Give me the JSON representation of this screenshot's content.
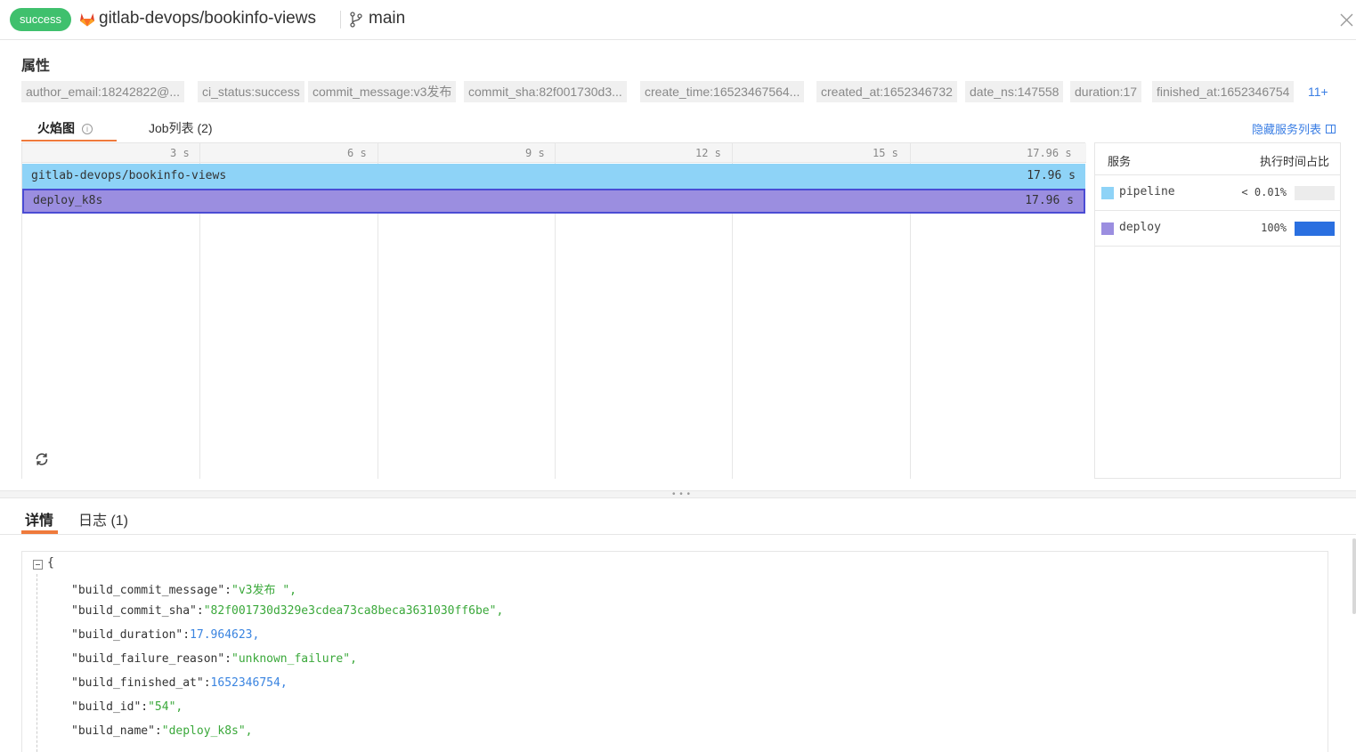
{
  "header": {
    "status": "success",
    "repo": "gitlab-devops/bookinfo-views",
    "branch": "main"
  },
  "attributes": {
    "title": "属性",
    "tags": [
      "author_email:18242822@...",
      "ci_status:success",
      "commit_message:v3发布",
      "commit_sha:82f001730d3...",
      "create_time:16523467564...",
      "created_at:1652346732",
      "date_ns:147558",
      "duration:17",
      "finished_at:1652346754"
    ],
    "more": "11+"
  },
  "tabs": {
    "flame": "火焰图",
    "jobs": "Job列表 (2)",
    "hide_services": "隐藏服务列表"
  },
  "flame": {
    "ticks": [
      "3 s",
      "6 s",
      "9 s",
      "12 s",
      "15 s",
      "17.96 s"
    ],
    "bars": [
      {
        "name": "gitlab-devops/bookinfo-views",
        "duration": "17.96 s"
      },
      {
        "name": "deploy_k8s",
        "duration": "17.96 s"
      }
    ]
  },
  "services": {
    "col_service": "服务",
    "col_ratio": "执行时间占比",
    "rows": [
      {
        "name": "pipeline",
        "pct": "< 0.01%",
        "fraction": 0.0001,
        "color": "#8ed3f7"
      },
      {
        "name": "deploy",
        "pct": "100%",
        "fraction": 1.0,
        "color": "#9b8ee0"
      }
    ]
  },
  "details": {
    "tab_details": "详情",
    "tab_logs": "日志 (1)",
    "open_brace": "{",
    "fields": [
      {
        "key": "\"build_commit_message\"",
        "value": "\"v3发布 \"",
        "type": "string"
      },
      {
        "key": "\"build_commit_sha\"",
        "value": "\"82f001730d329e3cdea73ca8beca3631030ff6be\"",
        "type": "string"
      },
      {
        "key": "\"build_duration\"",
        "value": "17.964623",
        "type": "number"
      },
      {
        "key": "\"build_failure_reason\"",
        "value": "\"unknown_failure\"",
        "type": "string"
      },
      {
        "key": "\"build_finished_at\"",
        "value": "1652346754",
        "type": "number"
      },
      {
        "key": "\"build_id\"",
        "value": "\"54\"",
        "type": "string"
      },
      {
        "key": "\"build_name\"",
        "value": "\"deploy_k8s\"",
        "type": "string"
      }
    ]
  },
  "colors": {
    "success": "#3fc06d",
    "accent": "#ef7a3c",
    "link": "#3a7ee4",
    "pipeline": "#8ed3f7",
    "deploy": "#9b8ee0"
  }
}
